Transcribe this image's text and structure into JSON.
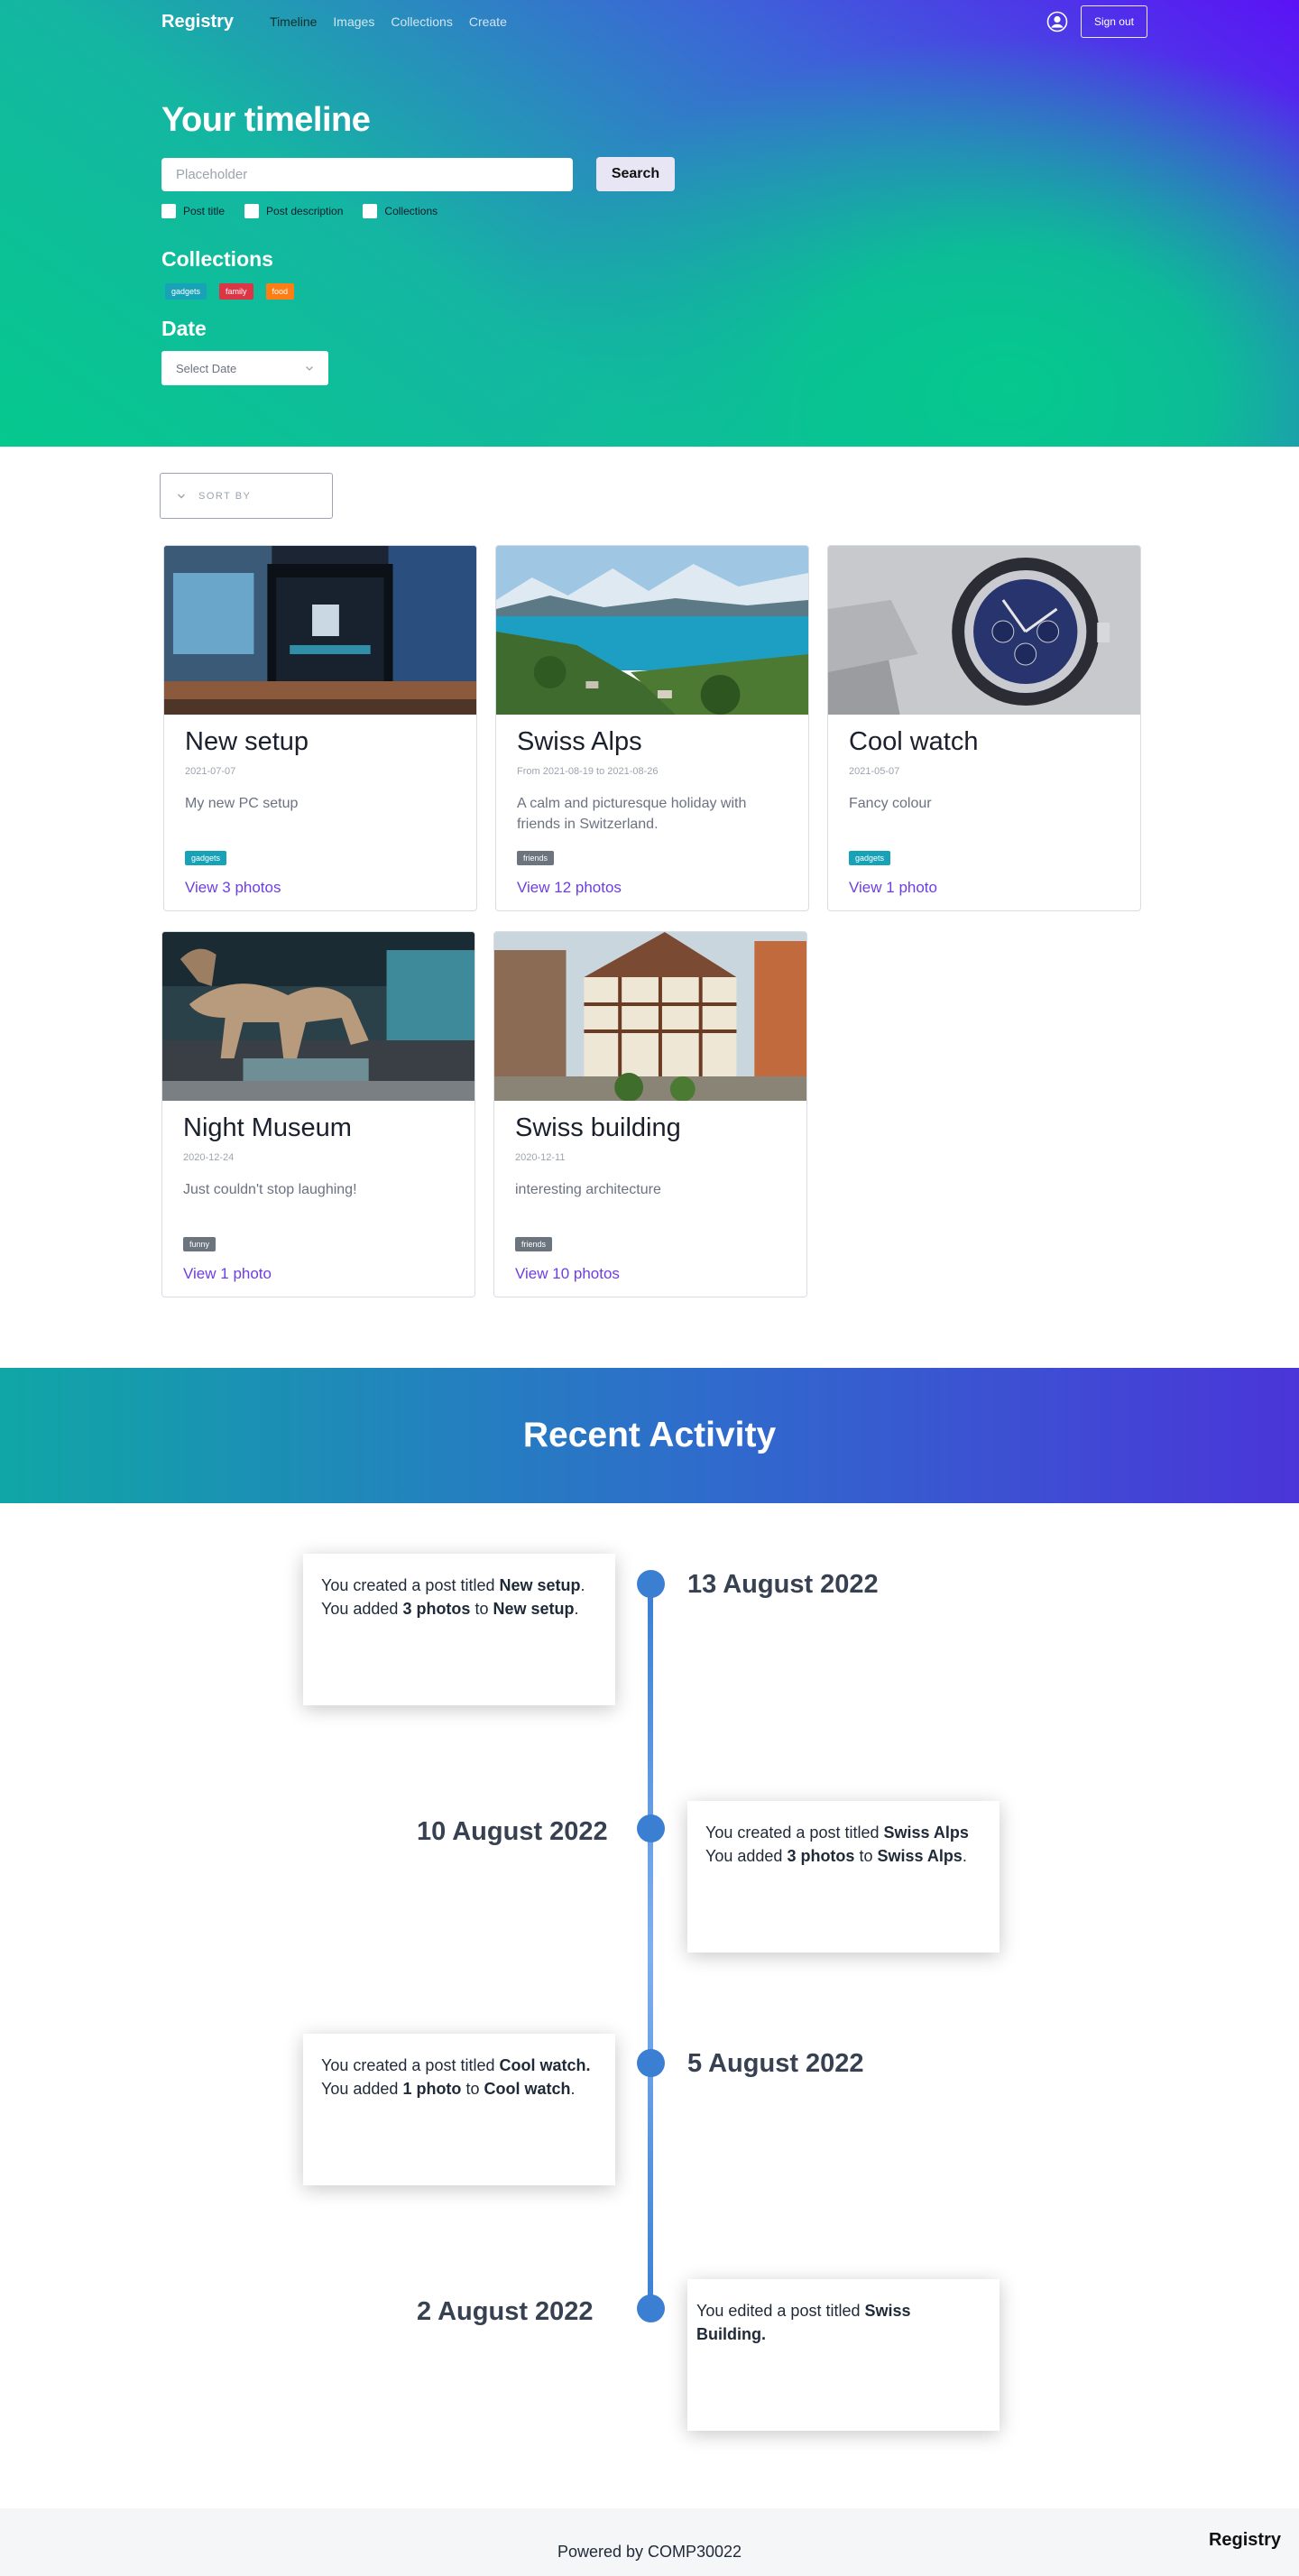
{
  "nav": {
    "brand": "Registry",
    "links": [
      "Timeline",
      "Images",
      "Collections",
      "Create"
    ],
    "active": "Timeline",
    "signout": "Sign out"
  },
  "hero": {
    "title": "Your timeline",
    "search_placeholder": "Placeholder",
    "search_button": "Search",
    "filters": [
      "Post title",
      "Post description",
      "Collections"
    ],
    "collections_heading": "Collections",
    "collections": [
      {
        "label": "gadgets",
        "color": "#17a2b8"
      },
      {
        "label": "family",
        "color": "#dc3545"
      },
      {
        "label": "food",
        "color": "#fd7e14"
      }
    ],
    "date_heading": "Date",
    "date_select": "Select Date"
  },
  "sort": {
    "label": "SORT BY"
  },
  "posts": [
    {
      "title": "New setup",
      "date": "2021-07-07",
      "desc": "My new PC setup",
      "tag": "gadgets",
      "tag_color": "#17a2b8",
      "link": "View 3 photos",
      "image": "pc-setup-image"
    },
    {
      "title": "Swiss Alps",
      "date": "From 2021-08-19 to 2021-08-26",
      "desc": "A calm and picturesque holiday with friends in Switzerland.",
      "tag": "friends",
      "tag_color": "#6c757d",
      "link": "View 12 photos",
      "image": "lake-mountains-image"
    },
    {
      "title": "Cool watch",
      "date": "2021-05-07",
      "desc": "Fancy colour",
      "tag": "gadgets",
      "tag_color": "#17a2b8",
      "link": "View 1 photo",
      "image": "watch-image"
    },
    {
      "title": "Night Museum",
      "date": "2020-12-24",
      "desc": "Just couldn't stop laughing!",
      "tag": "funny",
      "tag_color": "#6c757d",
      "link": "View 1 photo",
      "image": "museum-dinosaur-image"
    },
    {
      "title": "Swiss building",
      "date": "2020-12-11",
      "desc": "interesting architecture",
      "tag": "friends",
      "tag_color": "#6c757d",
      "link": "View 10 photos",
      "image": "timber-building-image"
    }
  ],
  "activity": {
    "heading": "Recent Activity",
    "entries": [
      {
        "date": "13 August 2022",
        "lines": [
          {
            "pre": "You created a post titled ",
            "b": "New setup",
            "post": "."
          },
          {
            "pre": "You added ",
            "b": "3 photos",
            "mid": " to ",
            "b2": "New setup",
            "post": "."
          }
        ]
      },
      {
        "date": "10 August 2022",
        "lines": [
          {
            "pre": "You created a post titled ",
            "b": "Swiss Alps",
            "post": ""
          },
          {
            "pre": "You added ",
            "b": "3 photos",
            "mid": " to ",
            "b2": "Swiss Alps",
            "post": "."
          }
        ]
      },
      {
        "date": "5 August 2022",
        "lines": [
          {
            "pre": "You created a post titled ",
            "b": "Cool watch.",
            "post": ""
          },
          {
            "pre": "You added ",
            "b": "1 photo",
            "mid": " to ",
            "b2": "Cool watch",
            "post": "."
          }
        ]
      },
      {
        "date": "2 August 2022",
        "lines": [
          {
            "pre": "You edited a post titled ",
            "b": "Swiss Building.",
            "post": ""
          }
        ]
      }
    ]
  },
  "footer": {
    "text": "Powered by COMP30022",
    "brand": "Registry"
  }
}
